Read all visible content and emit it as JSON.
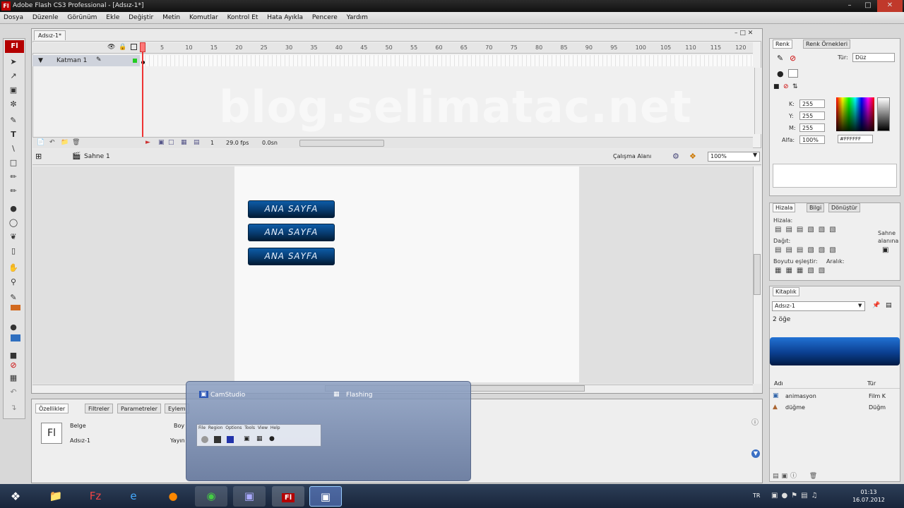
{
  "window": {
    "title": "Adobe Flash CS3 Professional - [Adsız-1*]",
    "app_icon": "Fl"
  },
  "menu": [
    "Dosya",
    "Düzenle",
    "Görünüm",
    "Ekle",
    "Değiştir",
    "Metin",
    "Komutlar",
    "Kontrol Et",
    "Hata Ayıkla",
    "Pencere",
    "Yardım"
  ],
  "document": {
    "tab": "Adsız-1*"
  },
  "timeline": {
    "layer_name": "Katman 1",
    "frame_numbers": [
      "5",
      "10",
      "15",
      "20",
      "25",
      "30",
      "35",
      "40",
      "45",
      "50",
      "55",
      "60",
      "65",
      "70",
      "75",
      "80",
      "85",
      "90",
      "95",
      "100",
      "105",
      "110",
      "115",
      "120"
    ],
    "current_frame": "1",
    "fps": "29.0 fps",
    "elapsed": "0.0sn"
  },
  "watermark": "blog.selimatac.net",
  "scene": {
    "name": "Sahne 1",
    "workspace": "Çalışma Alanı",
    "zoom": "100%"
  },
  "stage": {
    "buttons": [
      "ANA SAYFA",
      "ANA SAYFA",
      "ANA SAYFA"
    ]
  },
  "properties": {
    "tabs": [
      "Özellikler",
      "Filtreler",
      "Parametreler",
      "Eylem"
    ],
    "doc_label": "Belge",
    "doc_name": "Adsız-1",
    "size_label": "Boy",
    "publish_label": "Yayın",
    "fl_icon": "Fl"
  },
  "color_panel": {
    "tabs": [
      "Renk",
      "Renk Örnekleri"
    ],
    "type_label": "Tür:",
    "type_value": "Düz",
    "r_label": "K:",
    "r_value": "255",
    "g_label": "Y:",
    "g_value": "255",
    "b_label": "M:",
    "b_value": "255",
    "alpha_label": "Alfa:",
    "alpha_value": "100%",
    "hex": "#FFFFFF"
  },
  "align_panel": {
    "tabs": [
      "Hizala",
      "Bilgi",
      "Dönüştür"
    ],
    "align_label": "Hizala:",
    "distribute_label": "Dağıt:",
    "match_label": "Boyutu eşleştir:",
    "space_label": "Aralık:",
    "stage_label_1": "Sahne",
    "stage_label_2": "alanına"
  },
  "library_panel": {
    "tab": "Kitaplık",
    "doc": "Adsız-1",
    "count": "2 öğe",
    "col_name": "Adı",
    "col_type": "Tür",
    "items": [
      {
        "name": "animasyon",
        "type": "Film K"
      },
      {
        "name": "düğme",
        "type": "Düğm"
      }
    ]
  },
  "overlay": {
    "item1": "CamStudio",
    "item2": "Flashing",
    "menu": [
      "File",
      "Region",
      "Options",
      "Tools",
      "View",
      "Help"
    ]
  },
  "taskbar": {
    "lang": "TR",
    "time": "01:13",
    "date": "16.07.2012"
  },
  "colors": {
    "flash_red": "#b40000",
    "button_blue": "#073a6e",
    "taskbar": "#1f2d44"
  }
}
